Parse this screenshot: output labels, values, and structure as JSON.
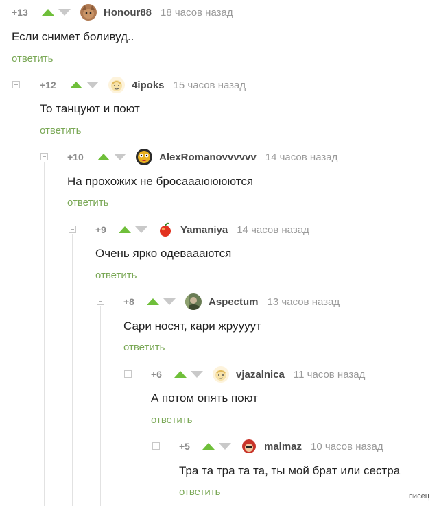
{
  "comments": [
    {
      "rating": "+13",
      "username": "Honour88",
      "time": "18 часов назад",
      "text": "Если снимет боливуд..",
      "reply_label": "ответить",
      "avatar": "cat-avatar"
    },
    {
      "rating": "+12",
      "username": "4ipoks",
      "time": "15 часов назад",
      "text": "То танцуют и поют",
      "reply_label": "ответить",
      "avatar": "cartoon-face-avatar"
    },
    {
      "rating": "+10",
      "username": "AlexRomanovvvvvv",
      "time": "14 часов назад",
      "text": "На прохожих не бросааaюююются",
      "reply_label": "ответить",
      "avatar": "dark-face-avatar"
    },
    {
      "rating": "+9",
      "username": "Yamaniya",
      "time": "14 часов назад",
      "text": "Очень ярко одеваааются",
      "reply_label": "ответить",
      "avatar": "red-apple-avatar"
    },
    {
      "rating": "+8",
      "username": "Aspectum",
      "time": "13 часов назад",
      "text": "Сари носят, кари жруууут",
      "reply_label": "ответить",
      "avatar": "green-photo-avatar"
    },
    {
      "rating": "+6",
      "username": "vjazalnica",
      "time": "11 часов назад",
      "text": "А потом опять поют",
      "reply_label": "ответить",
      "avatar": "cartoon-face-avatar"
    },
    {
      "rating": "+5",
      "username": "malmaz",
      "time": "10 часов назад",
      "text": "Тра та тра та та, ты мой брат или сестра",
      "reply_label": "ответить",
      "avatar": "red-hair-avatar"
    }
  ],
  "watermark": "писец",
  "colors": {
    "upvote": "#6fbf3a",
    "downvote": "#c9c9c9",
    "reply_link": "#7aa856",
    "meta": "#9a9a9a"
  }
}
